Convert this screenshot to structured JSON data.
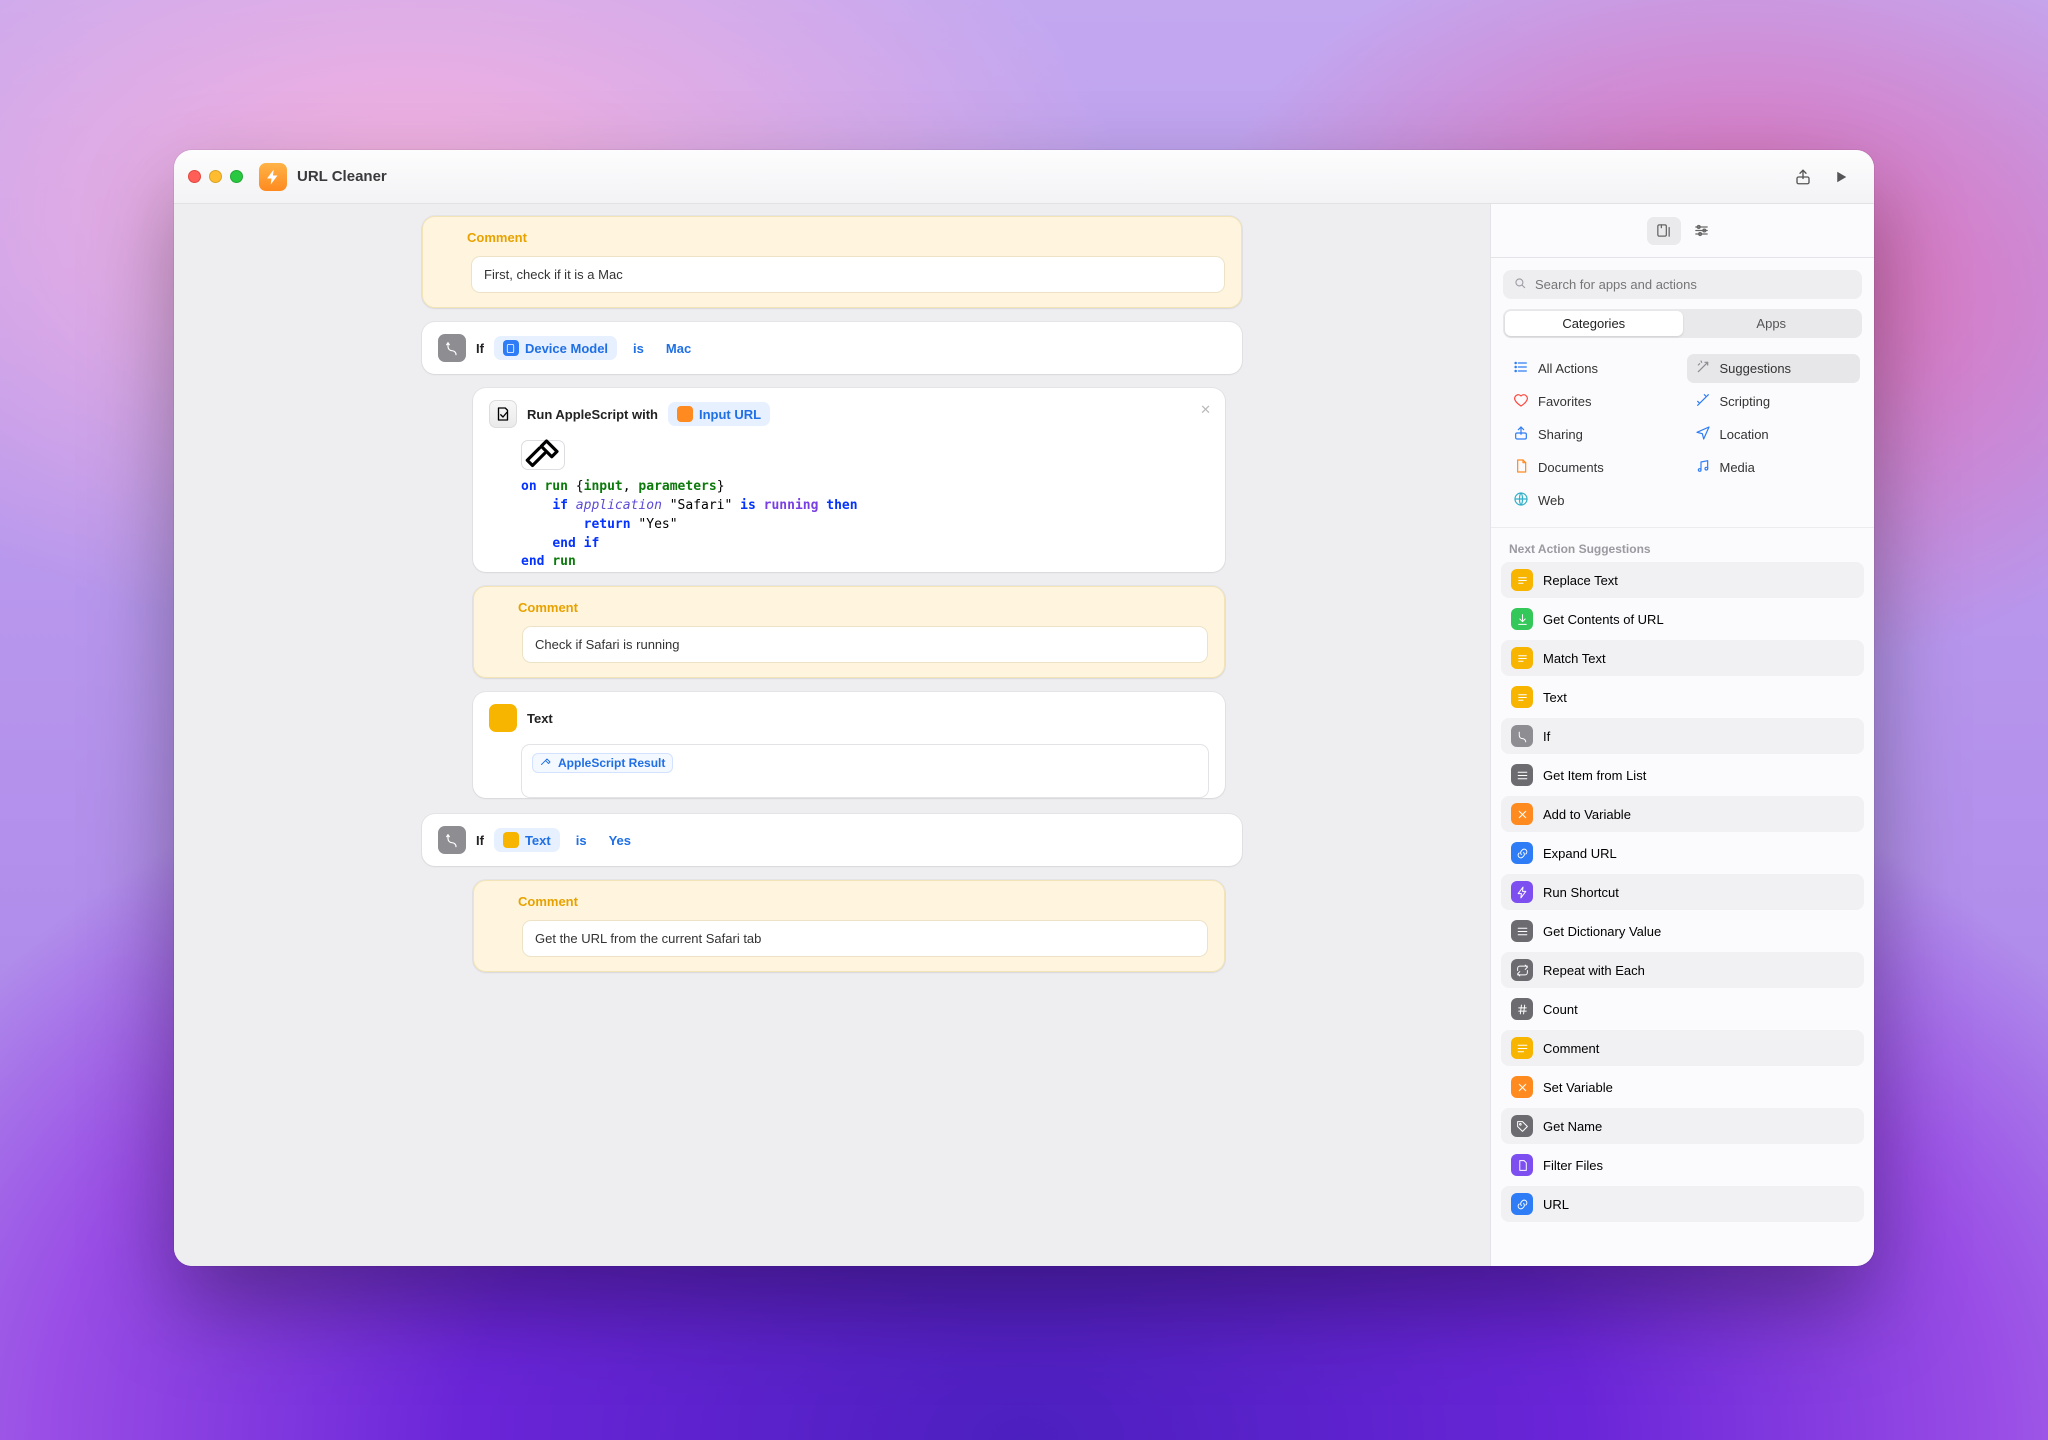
{
  "title": "URL Cleaner",
  "search_placeholder": "Search for apps and actions",
  "tabs": {
    "categories": "Categories",
    "apps": "Apps"
  },
  "categories": [
    {
      "label": "All Actions",
      "icon": "list",
      "color": "c-blue"
    },
    {
      "label": "Suggestions",
      "icon": "wand",
      "color": "c-gray",
      "active": true
    },
    {
      "label": "Favorites",
      "icon": "heart",
      "color": "c-red"
    },
    {
      "label": "Scripting",
      "icon": "wand2",
      "color": "c-blue"
    },
    {
      "label": "Sharing",
      "icon": "share",
      "color": "c-blue"
    },
    {
      "label": "Location",
      "icon": "loc",
      "color": "c-blue"
    },
    {
      "label": "Documents",
      "icon": "doc",
      "color": "c-orange"
    },
    {
      "label": "Media",
      "icon": "note",
      "color": "c-blue"
    },
    {
      "label": "Web",
      "icon": "globe",
      "color": "c-teal"
    }
  ],
  "suggestions_header": "Next Action Suggestions",
  "suggestions": [
    {
      "label": "Replace Text",
      "icon": "text",
      "color": "ic-yellow"
    },
    {
      "label": "Get Contents of URL",
      "icon": "dl",
      "color": "ic-green"
    },
    {
      "label": "Match Text",
      "icon": "text",
      "color": "ic-yellow"
    },
    {
      "label": "Text",
      "icon": "text",
      "color": "ic-yellow"
    },
    {
      "label": "If",
      "icon": "branch",
      "color": "ic-gray"
    },
    {
      "label": "Get Item from List",
      "icon": "list",
      "color": "ic-dgray"
    },
    {
      "label": "Add to Variable",
      "icon": "var",
      "color": "ic-orange"
    },
    {
      "label": "Expand URL",
      "icon": "link",
      "color": "ic-blue"
    },
    {
      "label": "Run Shortcut",
      "icon": "bolt",
      "color": "ic-purple"
    },
    {
      "label": "Get Dictionary Value",
      "icon": "list",
      "color": "ic-dgray"
    },
    {
      "label": "Repeat with Each",
      "icon": "repeat",
      "color": "ic-dgray"
    },
    {
      "label": "Count",
      "icon": "hash",
      "color": "ic-dgray"
    },
    {
      "label": "Comment",
      "icon": "comment",
      "color": "ic-yellow"
    },
    {
      "label": "Set Variable",
      "icon": "var",
      "color": "ic-orange"
    },
    {
      "label": "Get Name",
      "icon": "tag",
      "color": "ic-dgray"
    },
    {
      "label": "Filter Files",
      "icon": "doc",
      "color": "ic-purple"
    },
    {
      "label": "URL",
      "icon": "link",
      "color": "ic-blue"
    }
  ],
  "actions": {
    "comment1": {
      "title": "Comment",
      "text": "First, check if it is a Mac"
    },
    "if1": {
      "if": "If",
      "token": "Device Model",
      "op": "is",
      "val": "Mac"
    },
    "script": {
      "title_a": "Run AppleScript with",
      "title_b": "Input URL",
      "code_lines": [
        [
          [
            "kw",
            "on "
          ],
          [
            "fn",
            "run"
          ],
          [
            "pl",
            " {"
          ],
          [
            "fn",
            "input"
          ],
          [
            "pl",
            ", "
          ],
          [
            "fn",
            "parameters"
          ],
          [
            "pl",
            "}"
          ]
        ],
        [
          [
            "pl",
            "    "
          ],
          [
            "kw",
            "if "
          ],
          [
            "app",
            "application"
          ],
          [
            "pl",
            " \"Safari\" "
          ],
          [
            "kw",
            "is "
          ],
          [
            "run",
            "running "
          ],
          [
            "kw",
            "then"
          ]
        ],
        [
          [
            "pl",
            "        "
          ],
          [
            "kw",
            "return"
          ],
          [
            "pl",
            " \"Yes\""
          ]
        ],
        [
          [
            "pl",
            "    "
          ],
          [
            "kw",
            "end if"
          ]
        ],
        [
          [
            "kw",
            "end "
          ],
          [
            "fn",
            "run"
          ]
        ]
      ]
    },
    "comment2": {
      "title": "Comment",
      "text": "Check if Safari is running"
    },
    "text1": {
      "title": "Text",
      "token": "AppleScript Result"
    },
    "if2": {
      "if": "If",
      "token": "Text",
      "op": "is",
      "val": "Yes"
    },
    "comment3": {
      "title": "Comment",
      "text": "Get the URL from the current Safari tab"
    }
  }
}
